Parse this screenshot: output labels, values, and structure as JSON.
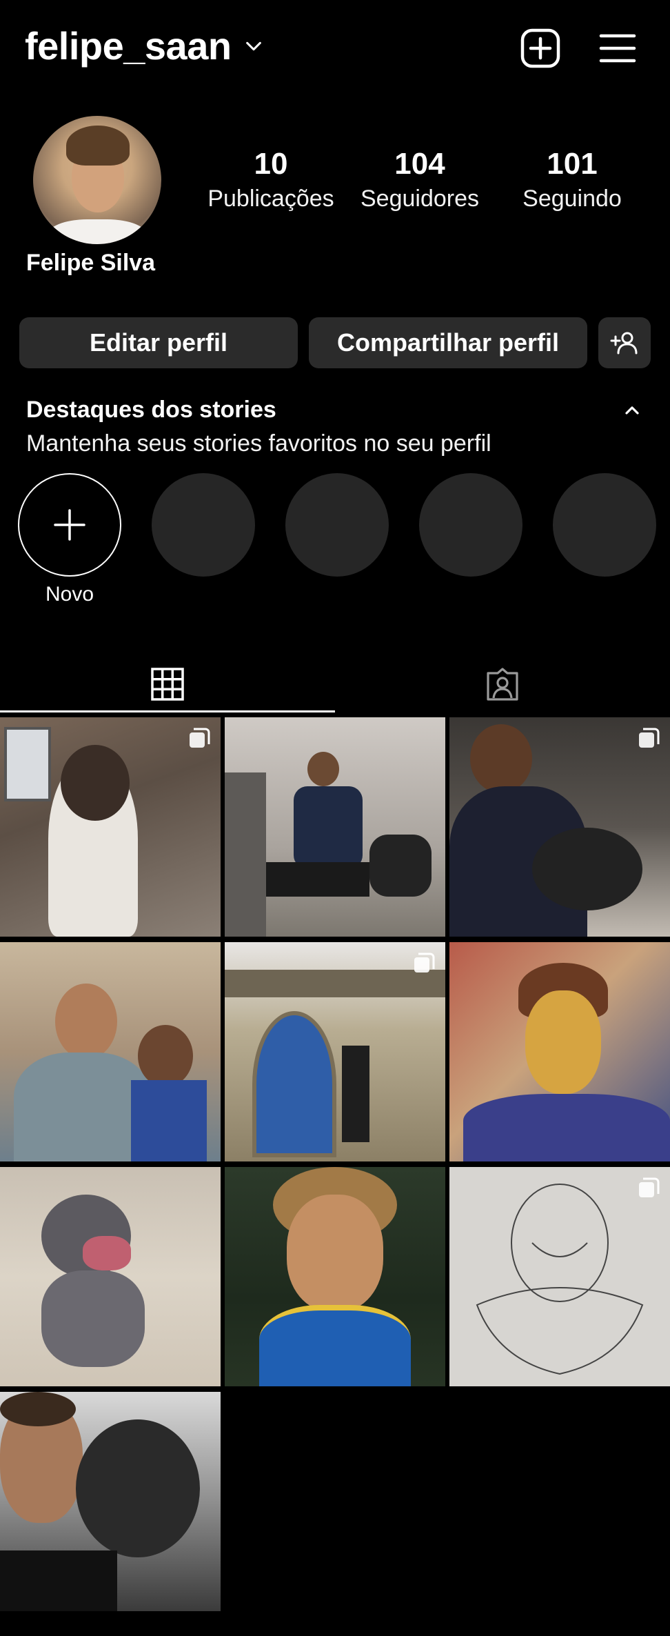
{
  "header": {
    "username": "felipe_saan",
    "icons": {
      "chevron": "chevron-down-icon",
      "add": "add-square-icon",
      "menu": "hamburger-menu-icon"
    }
  },
  "profile": {
    "full_name": "Felipe Silva",
    "stats": [
      {
        "value": "10",
        "label": "Publicações"
      },
      {
        "value": "104",
        "label": "Seguidores"
      },
      {
        "value": "101",
        "label": "Seguindo"
      }
    ]
  },
  "actions": {
    "edit": "Editar perfil",
    "share": "Compartilhar perfil",
    "discover_icon": "add-person-icon"
  },
  "highlights": {
    "title": "Destaques dos stories",
    "subtitle": "Mantenha seus stories favoritos no seu perfil",
    "new_label": "Novo"
  },
  "tabs": [
    {
      "name": "grid",
      "icon": "grid-icon",
      "active": true
    },
    {
      "name": "tagged",
      "icon": "tagged-user-icon",
      "active": false
    }
  ],
  "posts": [
    {
      "subject": "siamese cat",
      "multiple": true
    },
    {
      "subject": "selfie in restroom",
      "multiple": false
    },
    {
      "subject": "man with dog",
      "multiple": true
    },
    {
      "subject": "group selfie",
      "multiple": false
    },
    {
      "subject": "church door",
      "multiple": true
    },
    {
      "subject": "stylized portrait",
      "multiple": false
    },
    {
      "subject": "grey dog",
      "multiple": false
    },
    {
      "subject": "child portrait",
      "multiple": false
    },
    {
      "subject": "clown drawing",
      "multiple": true
    },
    {
      "subject": "selfie with statue",
      "multiple": false
    }
  ],
  "colors": {
    "background": "#000000",
    "button": "#2b2b2b",
    "placeholder_circle": "#262626",
    "text": "#ffffff"
  }
}
